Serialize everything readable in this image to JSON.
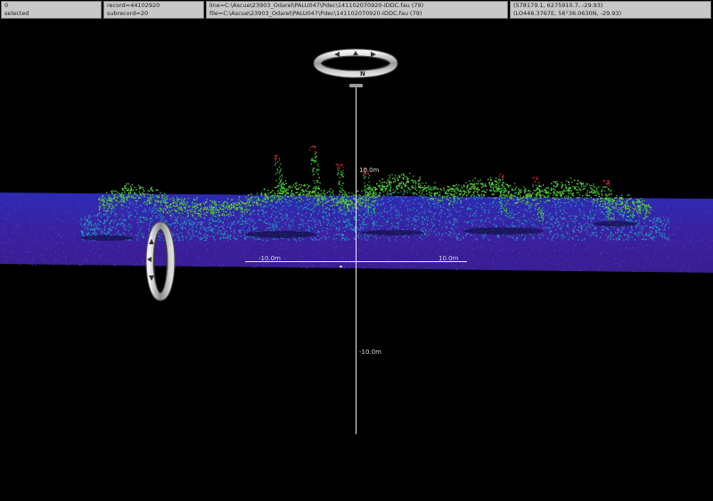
{
  "status_bar": {
    "cells": [
      {
        "line1": "0",
        "line2": "selected"
      },
      {
        "line1": "record=44102920",
        "line2": "subrecord=20"
      },
      {
        "line1": "line=C:\\Ascue\\23903_Odarel\\PALU047\\Pdec\\141102070920-IDDC.fau (79)",
        "line2": "file=C:\\Ascue\\23903_Odarel\\PALU047\\Pdec\\141102070920-IDDC.fau (79)"
      },
      {
        "line1": "(578179.1, 6275910.7, -29.93)",
        "line2": "(LO446.3767E, 56°36.0630N, -29.93)"
      }
    ]
  },
  "scene": {
    "compass_heading_label": "N",
    "axis_labels": {
      "vertical_positive": "10.0m",
      "vertical_negative": "-10.0m",
      "horizontal_negative": "-10.0m",
      "horizontal_positive": "10.0m"
    },
    "colors": {
      "background": "#000000",
      "seabed_band": "#3e1f9a",
      "seabed_band_upper": "#2f2fb0",
      "point_low": "#4a36c8",
      "point_mid": "#1aa8b8",
      "point_high": "#3fc43a",
      "point_peak": "#c0302a",
      "axis": "#e8e8e8",
      "ring": "#b8b8b8"
    }
  }
}
